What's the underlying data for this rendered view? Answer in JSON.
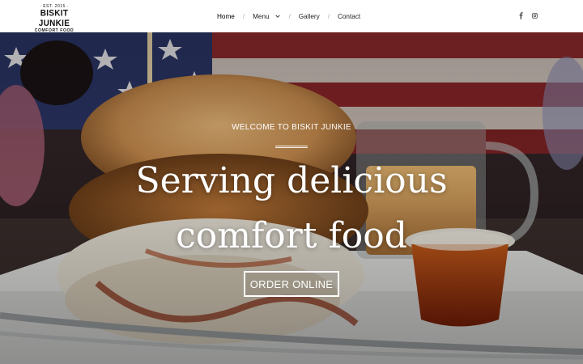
{
  "brand": {
    "est": "· EST. 2015 ·",
    "name": "BISKIT JUNKIE",
    "tagline": "COMFORT FOOD"
  },
  "nav": {
    "items": [
      {
        "label": "Home",
        "active": true
      },
      {
        "label": "Menu",
        "has_dropdown": true
      },
      {
        "label": "Gallery"
      },
      {
        "label": "Contact"
      }
    ],
    "separator": "/"
  },
  "social": {
    "icons": [
      "facebook-icon",
      "instagram-icon"
    ]
  },
  "hero": {
    "kicker": "WELCOME TO BISKIT JUNKIE",
    "headline_line1": "Serving delicious",
    "headline_line2": "comfort food",
    "cta_label": "ORDER ONLINE"
  },
  "colors": {
    "header_bg": "#ffffff",
    "text_dark": "#222222",
    "hero_text": "#ffffff"
  }
}
